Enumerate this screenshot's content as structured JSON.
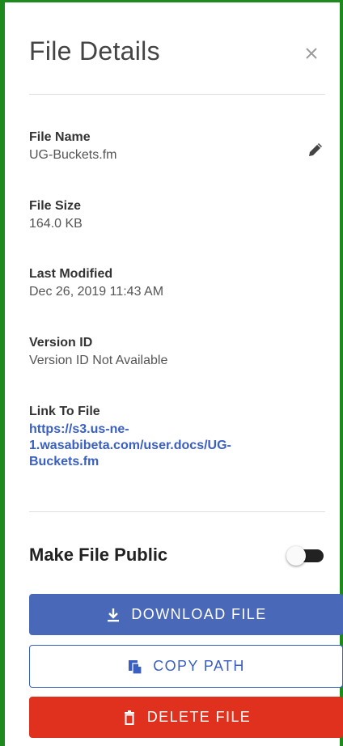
{
  "panel": {
    "title": "File Details"
  },
  "fields": {
    "file_name": {
      "label": "File Name",
      "value": "UG-Buckets.fm"
    },
    "file_size": {
      "label": "File Size",
      "value": "164.0 KB"
    },
    "last_modified": {
      "label": "Last Modified",
      "value": "Dec 26, 2019 11:43 AM"
    },
    "version_id": {
      "label": "Version ID",
      "value": "Version ID Not Available"
    },
    "link": {
      "label": "Link To File",
      "line1": "https://s3.us-ne-",
      "line2": "1.wasabibeta.com/user.docs/UG-",
      "line3": "Buckets.fm"
    }
  },
  "public_toggle": {
    "label": "Make File Public",
    "state": "off"
  },
  "buttons": {
    "download": "DOWNLOAD FILE",
    "copy": "COPY PATH",
    "delete": "DELETE FILE"
  },
  "colors": {
    "frame": "#1e8a1e",
    "primary": "#4a68b8",
    "link": "#3a5fc2",
    "danger": "#e0301e"
  },
  "icons": {
    "close": "close-icon",
    "edit": "pencil-icon",
    "download": "download-icon",
    "copy": "copy-file-icon",
    "delete": "trash-icon"
  }
}
